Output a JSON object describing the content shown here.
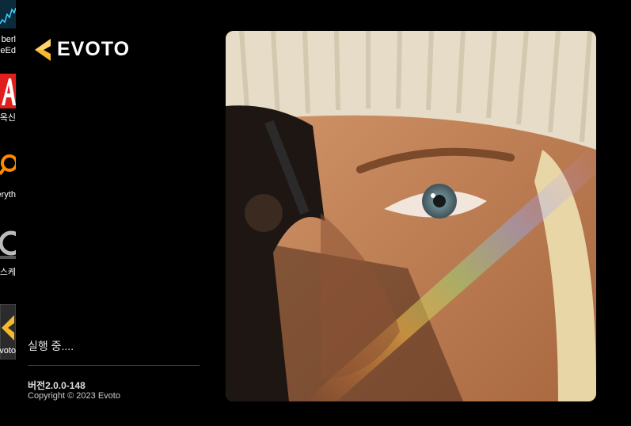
{
  "desktop": {
    "icons": [
      {
        "name": "app-icon-1",
        "label_lines": [
          "berl",
          "eEd"
        ]
      },
      {
        "name": "app-icon-2",
        "label_lines": [
          "옥신"
        ]
      },
      {
        "name": "everything-icon",
        "label_lines": [
          "eryth"
        ]
      },
      {
        "name": "photoscape-icon",
        "label_lines": [
          "스케"
        ]
      },
      {
        "name": "evoto-desktop-icon",
        "label_lines": [
          "Evoto"
        ]
      }
    ]
  },
  "splash": {
    "brand": "EVOTO",
    "status": "실행 중....",
    "version": "버전2.0.0-148",
    "copyright": "Copyright © 2023 Evoto",
    "accent": "#f5b82e"
  }
}
